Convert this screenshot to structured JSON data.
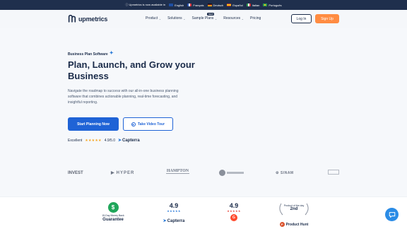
{
  "topbar": {
    "notice": "Upmetrics is now available in",
    "languages": [
      {
        "label": "English",
        "color": "#1e4fa3"
      },
      {
        "label": "Français",
        "color": "#2653b5"
      },
      {
        "label": "Deutsch",
        "color": "#d4a017"
      },
      {
        "label": "Español",
        "color": "#c7372f"
      },
      {
        "label": "Italian",
        "color": "#2e9e4f"
      },
      {
        "label": "Português",
        "color": "#2e9e4f"
      }
    ]
  },
  "nav": {
    "brand": "upmetrics",
    "items": [
      {
        "label": "Product",
        "has_chevron": true
      },
      {
        "label": "Solutions",
        "has_chevron": true
      },
      {
        "label": "Sample Plans",
        "has_chevron": true,
        "badge": "NEW"
      },
      {
        "label": "Resources",
        "has_chevron": true
      },
      {
        "label": "Pricing",
        "has_chevron": false
      }
    ],
    "login": "Log In",
    "signup": "Sign Up"
  },
  "hero": {
    "eyebrow": "Business Plan Software",
    "headline": "Plan, Launch, and Grow your Business",
    "description": "Navigate the roadmap to success with our all-in-one business planning software that combines actionable planning, real-time forecasting, and insightful reporting.",
    "primary_cta": "Start Planning Now",
    "secondary_cta": "Take Video Tour",
    "rating_label": "Excellent",
    "rating_score": "4.9/5.0",
    "rating_source": "Capterra"
  },
  "clients": [
    "INVEST",
    "HYPER",
    "HAMPTON",
    "",
    "SINAM",
    ""
  ],
  "badges": {
    "guarantee_top": "15-Day Money Back",
    "guarantee_main": "Guarantee",
    "capterra_score": "4.9",
    "capterra_label": "Capterra",
    "g2_score": "4.9",
    "ph_top": "Product of the day",
    "ph_rank": "2nd",
    "ph_brand": "Product Hunt"
  },
  "colors": {
    "accent": "#1f63d6",
    "signup": "#ff8c42",
    "topbar": "#1f2f4d"
  }
}
